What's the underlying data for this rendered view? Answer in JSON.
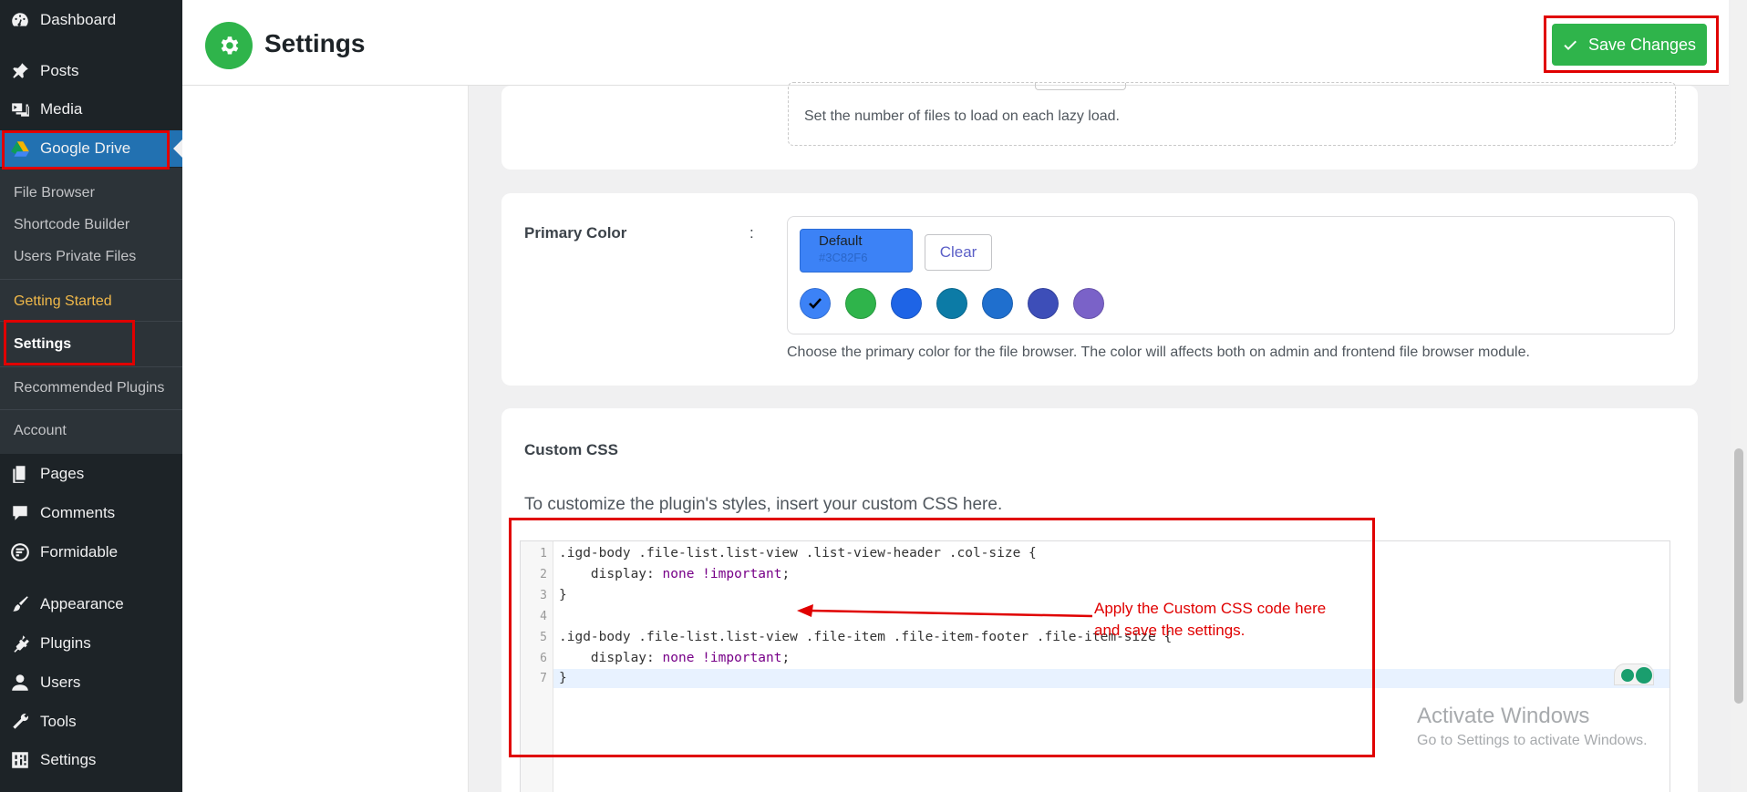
{
  "sidebar": {
    "items": [
      {
        "label": "Dashboard",
        "icon": "dashboard-icon"
      },
      {
        "label": "Posts",
        "icon": "pin-icon"
      },
      {
        "label": "Media",
        "icon": "media-icon"
      },
      {
        "label": "Google Drive",
        "icon": "google-drive-icon"
      },
      {
        "label": "Pages",
        "icon": "pages-icon"
      },
      {
        "label": "Comments",
        "icon": "comment-icon"
      },
      {
        "label": "Formidable",
        "icon": "formidable-icon"
      },
      {
        "label": "Appearance",
        "icon": "brush-icon"
      },
      {
        "label": "Plugins",
        "icon": "plugin-icon"
      },
      {
        "label": "Users",
        "icon": "user-icon"
      },
      {
        "label": "Tools",
        "icon": "wrench-icon"
      },
      {
        "label": "Settings",
        "icon": "settings-sliders-icon"
      }
    ],
    "submenu": [
      {
        "label": "File Browser"
      },
      {
        "label": "Shortcode Builder"
      },
      {
        "label": "Users Private Files"
      },
      {
        "label": "Getting Started"
      },
      {
        "label": "Settings"
      },
      {
        "label": "Recommended Plugins"
      },
      {
        "label": "Account"
      }
    ]
  },
  "header": {
    "title": "Settings",
    "save_label": "Save Changes"
  },
  "lazy_load": {
    "help": "Set the number of files to load on each lazy load."
  },
  "primary_color": {
    "label": "Primary Color",
    "separator": ":",
    "default_label": "Default",
    "default_hex": "#3C82F6",
    "clear_label": "Clear",
    "swatches": [
      "#3c82f6",
      "#2fb44b",
      "#1e64e6",
      "#0c7ba6",
      "#1f6fce",
      "#3d4eb8",
      "#7a62c8"
    ],
    "help": "Choose the primary color for the file browser. The color will affects both on admin and frontend file browser module."
  },
  "custom_css": {
    "title": "Custom CSS",
    "help": "To customize the plugin's styles, insert your custom CSS here.",
    "lines": [
      ".igd-body .file-list.list-view .list-view-header .col-size {",
      "    display: none !important;",
      "}",
      "",
      ".igd-body .file-list.list-view .file-item .file-item-footer .file-item-size {",
      "    display: none !important;",
      "}"
    ],
    "line_numbers": [
      "1",
      "2",
      "3",
      "4",
      "5",
      "6",
      "7"
    ]
  },
  "annotation": {
    "line1": "Apply the Custom CSS code here",
    "line2": "and save the settings."
  },
  "watermark": {
    "line1": "Activate Windows",
    "line2": "Go to Settings to activate Windows."
  }
}
